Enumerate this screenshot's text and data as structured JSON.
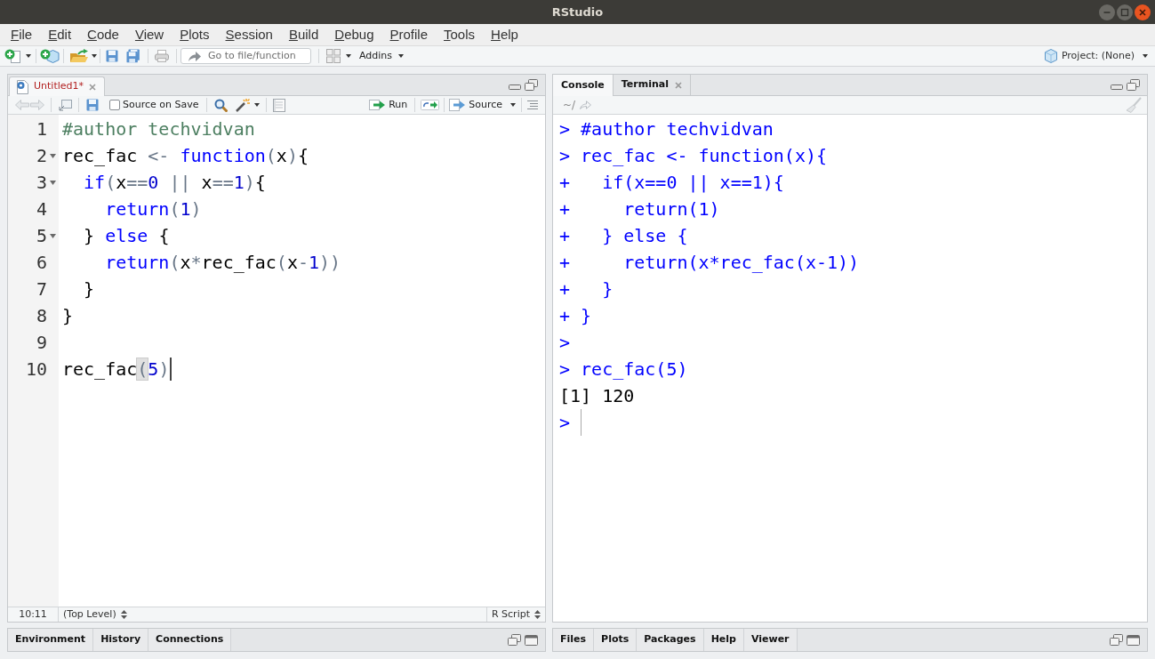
{
  "window": {
    "title": "RStudio"
  },
  "menu": [
    "File",
    "Edit",
    "Code",
    "View",
    "Plots",
    "Session",
    "Build",
    "Debug",
    "Profile",
    "Tools",
    "Help"
  ],
  "toolbar": {
    "go_to_file": {
      "placeholder": "Go to file/function"
    },
    "addins": "Addins",
    "project": "Project: (None)"
  },
  "editor": {
    "tabs": [
      {
        "label": "Untitled1*",
        "selected": true,
        "modified": true
      }
    ],
    "source_on_save": {
      "label": "Source on Save",
      "checked": false
    },
    "run": "Run",
    "source": "Source",
    "lines": [
      {
        "number": "1",
        "foldable": false,
        "cursor": false,
        "tokens": [
          {
            "kind": "comment",
            "text": "#author techvidvan",
            "matched": false
          }
        ]
      },
      {
        "number": "2",
        "foldable": true,
        "cursor": false,
        "tokens": [
          {
            "kind": "plain",
            "text": "rec_fac ",
            "matched": false
          },
          {
            "kind": "operator",
            "text": "<-",
            "matched": false
          },
          {
            "kind": "keyword",
            "text": " function",
            "matched": false
          },
          {
            "kind": "paren",
            "text": "(",
            "matched": false
          },
          {
            "kind": "plain",
            "text": "x",
            "matched": false
          },
          {
            "kind": "paren",
            "text": ")",
            "matched": false
          },
          {
            "kind": "plain",
            "text": "{",
            "matched": false
          }
        ]
      },
      {
        "number": "3",
        "foldable": true,
        "cursor": false,
        "tokens": [
          {
            "kind": "keyword",
            "text": "  if",
            "matched": false
          },
          {
            "kind": "paren",
            "text": "(",
            "matched": false
          },
          {
            "kind": "plain",
            "text": "x",
            "matched": false
          },
          {
            "kind": "operator",
            "text": "==",
            "matched": false
          },
          {
            "kind": "number",
            "text": "0",
            "matched": false
          },
          {
            "kind": "operator",
            "text": " || ",
            "matched": false
          },
          {
            "kind": "plain",
            "text": "x",
            "matched": false
          },
          {
            "kind": "operator",
            "text": "==",
            "matched": false
          },
          {
            "kind": "number",
            "text": "1",
            "matched": false
          },
          {
            "kind": "paren",
            "text": ")",
            "matched": false
          },
          {
            "kind": "plain",
            "text": "{",
            "matched": false
          }
        ]
      },
      {
        "number": "4",
        "foldable": false,
        "cursor": false,
        "tokens": [
          {
            "kind": "keyword",
            "text": "    return",
            "matched": false
          },
          {
            "kind": "paren",
            "text": "(",
            "matched": false
          },
          {
            "kind": "number",
            "text": "1",
            "matched": false
          },
          {
            "kind": "paren",
            "text": ")",
            "matched": false
          }
        ]
      },
      {
        "number": "5",
        "foldable": true,
        "cursor": false,
        "tokens": [
          {
            "kind": "plain",
            "text": "  } ",
            "matched": false
          },
          {
            "kind": "keyword",
            "text": "else",
            "matched": false
          },
          {
            "kind": "plain",
            "text": " {",
            "matched": false
          }
        ]
      },
      {
        "number": "6",
        "foldable": false,
        "cursor": false,
        "tokens": [
          {
            "kind": "keyword",
            "text": "    return",
            "matched": false
          },
          {
            "kind": "paren",
            "text": "(",
            "matched": false
          },
          {
            "kind": "plain",
            "text": "x",
            "matched": false
          },
          {
            "kind": "operator",
            "text": "*",
            "matched": false
          },
          {
            "kind": "plain",
            "text": "rec_fac",
            "matched": false
          },
          {
            "kind": "paren",
            "text": "(",
            "matched": false
          },
          {
            "kind": "plain",
            "text": "x",
            "matched": false
          },
          {
            "kind": "operator",
            "text": "-",
            "matched": false
          },
          {
            "kind": "number",
            "text": "1",
            "matched": false
          },
          {
            "kind": "paren",
            "text": ")",
            "matched": false
          },
          {
            "kind": "paren",
            "text": ")",
            "matched": false
          }
        ]
      },
      {
        "number": "7",
        "foldable": false,
        "cursor": false,
        "tokens": [
          {
            "kind": "plain",
            "text": "  }",
            "matched": false
          }
        ]
      },
      {
        "number": "8",
        "foldable": false,
        "cursor": false,
        "tokens": [
          {
            "kind": "plain",
            "text": "}",
            "matched": false
          }
        ]
      },
      {
        "number": "9",
        "foldable": false,
        "cursor": false
      },
      {
        "number": "10",
        "foldable": false,
        "cursor": true,
        "tokens": [
          {
            "kind": "plain",
            "text": "rec_fac",
            "matched": false
          },
          {
            "kind": "paren",
            "text": "(",
            "matched": true
          },
          {
            "kind": "number",
            "text": "5",
            "matched": false
          },
          {
            "kind": "paren",
            "text": ")",
            "matched": false
          }
        ]
      }
    ],
    "status": {
      "position": "10:11",
      "scope": "(Top Level)",
      "file_type": "R Script"
    }
  },
  "console": {
    "tabs": [
      {
        "label": "Console",
        "selected": true,
        "closable": false
      },
      {
        "label": "Terminal",
        "selected": false,
        "closable": true
      }
    ],
    "path": "~/",
    "lines": [
      {
        "kind": "input",
        "prompt": ">",
        "code": "#author techvidvan",
        "cursor": false
      },
      {
        "kind": "input",
        "prompt": ">",
        "code": "rec_fac <- function(x){",
        "cursor": false
      },
      {
        "kind": "input",
        "prompt": "+",
        "code": "  if(x==0 || x==1){",
        "cursor": false
      },
      {
        "kind": "input",
        "prompt": "+",
        "code": "    return(1)",
        "cursor": false
      },
      {
        "kind": "input",
        "prompt": "+",
        "code": "  } else {",
        "cursor": false
      },
      {
        "kind": "input",
        "prompt": "+",
        "code": "    return(x*rec_fac(x-1))",
        "cursor": false
      },
      {
        "kind": "input",
        "prompt": "+",
        "code": "  }",
        "cursor": false
      },
      {
        "kind": "input",
        "prompt": "+",
        "code": "}",
        "cursor": false
      },
      {
        "kind": "input",
        "prompt": ">",
        "cursor": false
      },
      {
        "kind": "input",
        "prompt": ">",
        "code": "rec_fac(5)",
        "cursor": false
      },
      {
        "kind": "output",
        "text": "[1] 120",
        "cursor": false
      },
      {
        "kind": "input",
        "prompt": ">",
        "cursor": true
      }
    ]
  },
  "environment_pane": {
    "tabs": [
      {
        "label": "Environment",
        "selected": false
      },
      {
        "label": "History",
        "selected": false
      },
      {
        "label": "Connections",
        "selected": false
      }
    ]
  },
  "files_pane": {
    "tabs": [
      {
        "label": "Files",
        "selected": false
      },
      {
        "label": "Plots",
        "selected": false
      },
      {
        "label": "Packages",
        "selected": false
      },
      {
        "label": "Help",
        "selected": false
      },
      {
        "label": "Viewer",
        "selected": false
      }
    ]
  }
}
